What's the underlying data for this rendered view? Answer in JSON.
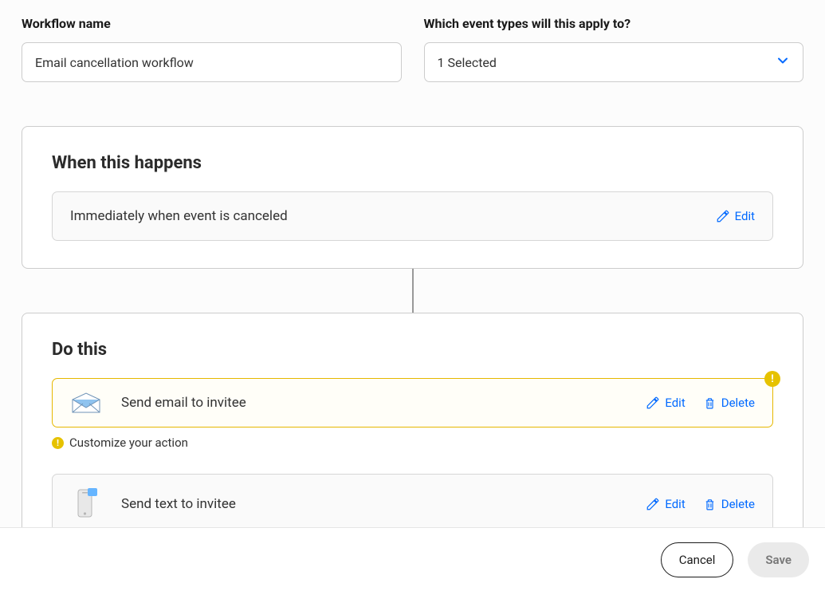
{
  "workflow_name": {
    "label": "Workflow name",
    "value": "Email cancellation workflow"
  },
  "event_types": {
    "label": "Which event types will this apply to?",
    "selected_text": "1 Selected"
  },
  "trigger": {
    "section_title": "When this happens",
    "description": "Immediately when event is canceled",
    "edit_label": "Edit"
  },
  "actions": {
    "section_title": "Do this",
    "customize_hint": "Customize your action",
    "items": [
      {
        "label": "Send email to invitee",
        "edit_label": "Edit",
        "delete_label": "Delete",
        "has_warning": true
      },
      {
        "label": "Send text to invitee",
        "edit_label": "Edit",
        "delete_label": "Delete",
        "has_warning": false
      }
    ]
  },
  "footer": {
    "cancel_label": "Cancel",
    "save_label": "Save"
  },
  "colors": {
    "link_blue": "#0069ff",
    "warning_yellow": "#e6c200"
  }
}
